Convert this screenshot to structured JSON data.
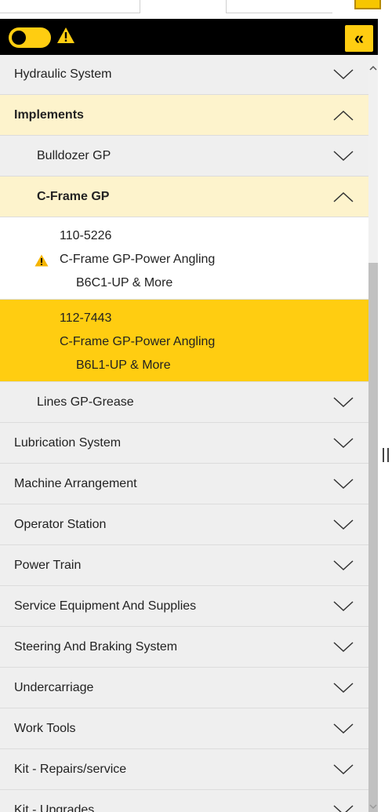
{
  "accent_color": "#ffcd11",
  "header": {
    "collapse_label": "«",
    "toggle_icon": "toggle-switch-icon",
    "warning_icon": "warning-icon"
  },
  "tree": {
    "hydraulic_system": "Hydraulic System",
    "implements": "Implements",
    "bulldozer_gp": "Bulldozer GP",
    "c_frame_gp": "C-Frame GP",
    "parts": [
      {
        "number": "110-5226",
        "name": "C-Frame GP-Power Angling",
        "serial": "B6C1-UP & More"
      },
      {
        "number": "112-7443",
        "name": "C-Frame GP-Power Angling",
        "serial": "B6L1-UP & More"
      }
    ],
    "lines_gp_grease": "Lines GP-Grease",
    "lubrication_system": "Lubrication System",
    "machine_arrangement": "Machine Arrangement",
    "operator_station": "Operator Station",
    "power_train": "Power Train",
    "service_equipment": "Service Equipment And Supplies",
    "steering_braking": "Steering And Braking System",
    "undercarriage": "Undercarriage",
    "work_tools": "Work Tools",
    "kit_repairs": "Kit - Repairs/service",
    "kit_upgrades": "Kit - Upgrades"
  }
}
